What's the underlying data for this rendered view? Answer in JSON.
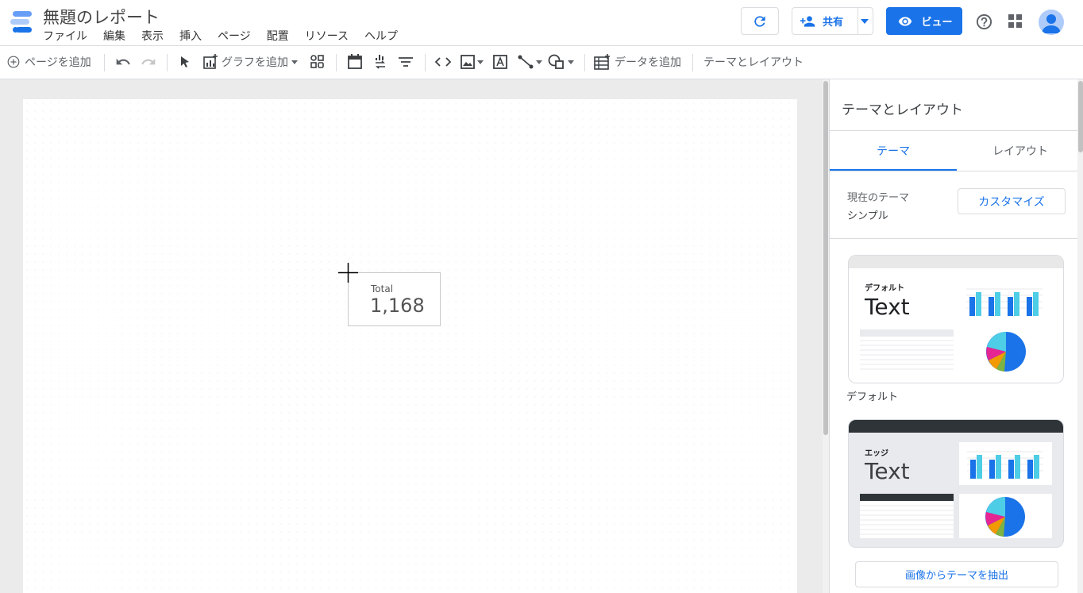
{
  "app": {
    "title": "無題のレポート",
    "menu": [
      "ファイル",
      "編集",
      "表示",
      "挿入",
      "ページ",
      "配置",
      "リソース",
      "ヘルプ"
    ]
  },
  "header": {
    "share_label": "共有",
    "view_label": "ビュー",
    "accent_color": "#1a73e8"
  },
  "toolbar": {
    "add_page": "ページを追加",
    "add_chart": "グラフを追加",
    "add_data": "データを追加",
    "theme_layout": "テーマとレイアウト",
    "icons": [
      "add-page-icon",
      "undo-icon",
      "redo-icon",
      "select-icon",
      "add-chart-icon",
      "community-viz-icon",
      "date-range-icon",
      "data-control-icon",
      "filter-control-icon",
      "embed-url-icon",
      "image-icon",
      "text-icon",
      "line-icon",
      "shape-icon",
      "add-data-icon"
    ]
  },
  "canvas": {
    "scorecard": {
      "label": "Total",
      "value": "1,168"
    }
  },
  "panel": {
    "title": "テーマとレイアウト",
    "tabs": [
      {
        "label": "テーマ",
        "active": true
      },
      {
        "label": "レイアウト",
        "active": false
      }
    ],
    "current_theme_label": "現在のテーマ",
    "current_theme_value": "シンプル",
    "customize_label": "カスタマイズ",
    "themes": [
      {
        "card_name": "デフォルト",
        "sample_text": "Text",
        "label": "デフォルト"
      },
      {
        "card_name": "エッジ",
        "sample_text": "Text"
      }
    ],
    "extract_label": "画像からテーマを抽出"
  }
}
